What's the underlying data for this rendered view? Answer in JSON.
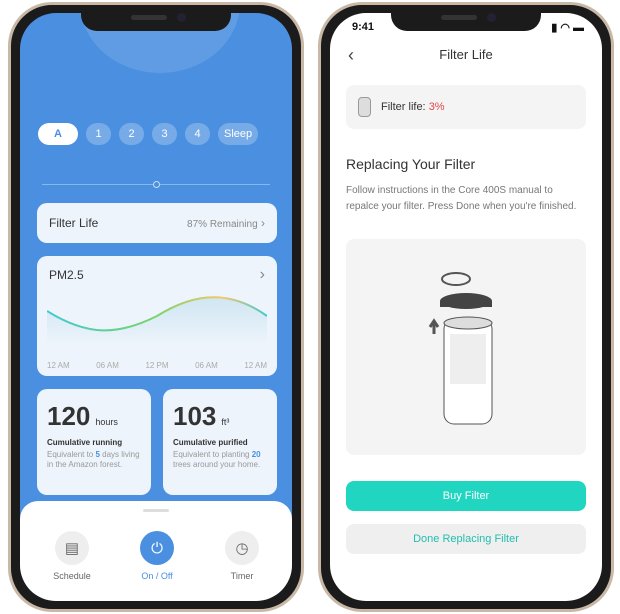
{
  "left": {
    "modes": [
      "A",
      "1",
      "2",
      "3",
      "4",
      "Sleep"
    ],
    "filter_life": {
      "label": "Filter Life",
      "value": "87% Remaining"
    },
    "pm": {
      "title": "PM2.5",
      "ticks": [
        "12 AM",
        "06 AM",
        "12 PM",
        "06 AM",
        "12 AM"
      ]
    },
    "running": {
      "value": "120",
      "unit": "hours",
      "label": "Cumulative running",
      "desc_pre": "Equivalent to ",
      "num": "5",
      "desc_post": " days living in the Amazon forest."
    },
    "purified": {
      "value": "103",
      "unit": "ft³",
      "label": "Cumulative purified",
      "desc_pre": "Equivalent to planting ",
      "num": "20",
      "desc_post": " trees around your home."
    },
    "actions": [
      {
        "label": "Schedule",
        "icon": "calendar-icon"
      },
      {
        "label": "On / Off",
        "icon": "power-icon"
      },
      {
        "label": "Timer",
        "icon": "timer-icon"
      }
    ],
    "accent": "#4a8fe0"
  },
  "right": {
    "time": "9:41",
    "title": "Filter Life",
    "filter_label": "Filter life: ",
    "filter_value": "3%",
    "heading": "Replacing Your Filter",
    "instructions": "Follow instructions in the Core 400S manual to repalce your filter. Press Done when you're finished.",
    "buy": "Buy Filter",
    "done": "Done Replacing Filter",
    "accent": "#20d6c0"
  }
}
